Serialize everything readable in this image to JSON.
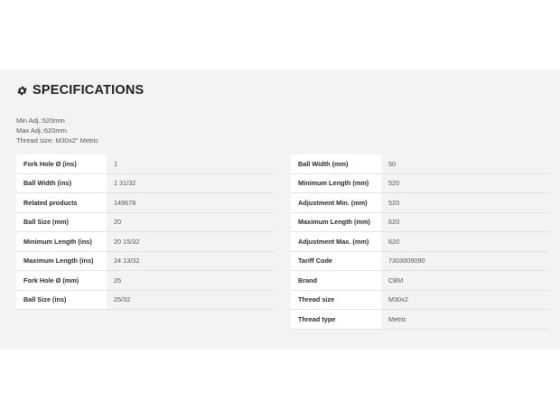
{
  "section": {
    "title": "SPECIFICATIONS",
    "icon": "gear-icon"
  },
  "notes": [
    "Min Adj.:520mm",
    "Max Adj.:620mm",
    "Thread size: M30x2\" Metric"
  ],
  "left_table": [
    {
      "label": "Fork Hole Ø (ins)",
      "value": "1"
    },
    {
      "label": "Ball Width (ins)",
      "value": "1 31/32"
    },
    {
      "label": "Related products",
      "value": "149678"
    },
    {
      "label": "Ball Size (mm)",
      "value": "20"
    },
    {
      "label": "Minimum Length (ins)",
      "value": "20 15/32"
    },
    {
      "label": "Maximum Length (ins)",
      "value": "24 13/32"
    },
    {
      "label": "Fork Hole Ø (mm)",
      "value": "25"
    },
    {
      "label": "Ball Size (ins)",
      "value": "25/32"
    }
  ],
  "right_table": [
    {
      "label": "Ball Width (mm)",
      "value": "50"
    },
    {
      "label": "Minimum Length (mm)",
      "value": "520"
    },
    {
      "label": "Adjustment Min. (mm)",
      "value": "520"
    },
    {
      "label": "Maximum Length (mm)",
      "value": "620"
    },
    {
      "label": "Adjustment Max. (mm)",
      "value": "620"
    },
    {
      "label": "Tariff Code",
      "value": "7303009090"
    },
    {
      "label": "Brand",
      "value": "CBM"
    },
    {
      "label": "Thread size",
      "value": "M30x2"
    },
    {
      "label": "Thread type",
      "value": "Metric"
    }
  ]
}
